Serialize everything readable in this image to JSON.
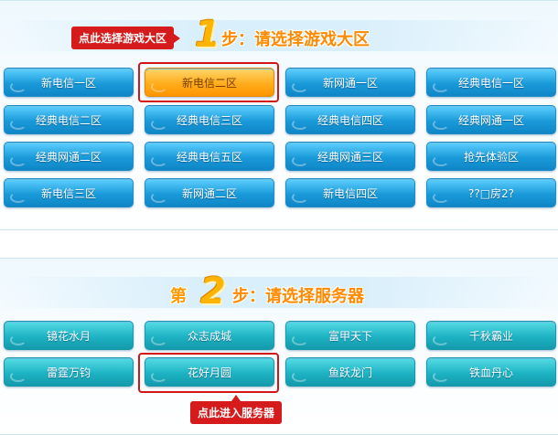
{
  "step1": {
    "number": "1",
    "label": "步：请选择游戏大区",
    "tooltip": "点此选择游戏大区",
    "regions": [
      [
        "新电信一区",
        "新电信二区",
        "新网通一区",
        "经典电信一区"
      ],
      [
        "经典电信二区",
        "经典电信三区",
        "经典电信四区",
        "经典网通一区"
      ],
      [
        "经典网通二区",
        "经典电信五区",
        "经典网通三区",
        "抢先体验区"
      ],
      [
        "新电信三区",
        "新网通二区",
        "新电信四区",
        "??□房2?"
      ]
    ],
    "selected": "新电信二区"
  },
  "step2": {
    "prefix": "第",
    "number": "2",
    "label": "步：请选择服务器",
    "tooltip": "点此进入服务器",
    "servers": [
      [
        "镜花水月",
        "众志成城",
        "富甲天下",
        "千秋霸业"
      ],
      [
        "雷霆万钧",
        "花好月圆",
        "鱼跃龙门",
        "铁血丹心"
      ]
    ],
    "selected": "花好月圆"
  },
  "colors": {
    "region_button": "#1a9ad9",
    "server_button": "#1eb3c4",
    "selected_button": "#ffad1d",
    "highlight": "#d31515",
    "title": "#ff8a00"
  }
}
